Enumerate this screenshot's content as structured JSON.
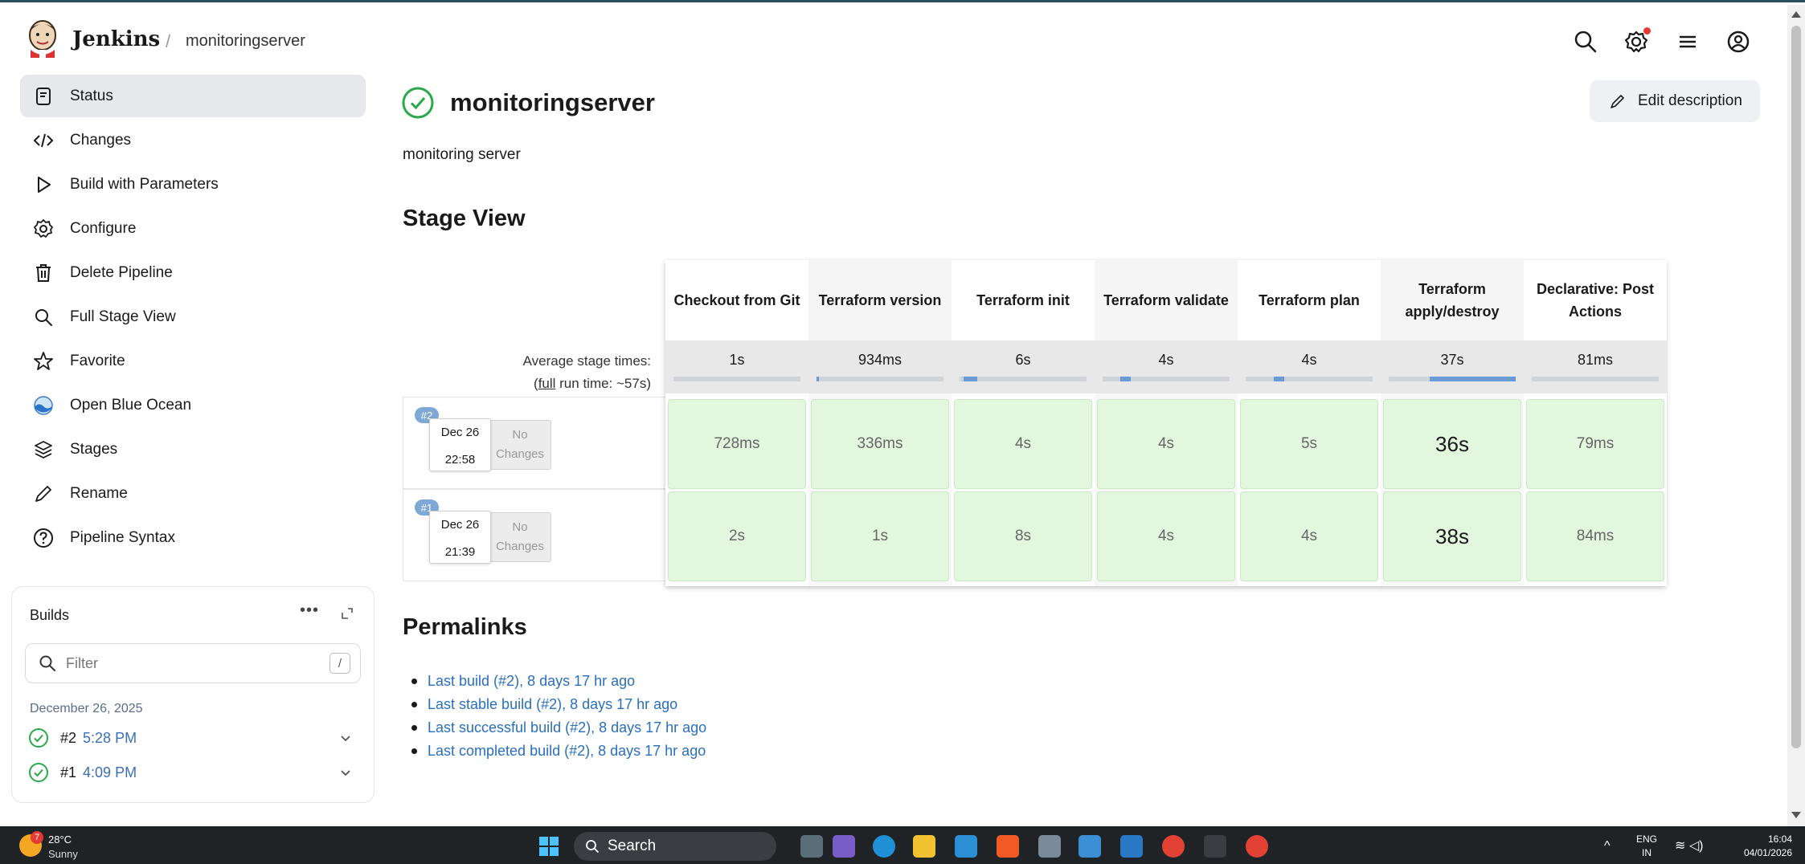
{
  "header": {
    "brand": "Jenkins",
    "breadcrumb_sep": "/",
    "breadcrumb": "monitoringserver"
  },
  "sidebar": {
    "items": [
      {
        "label": "Status",
        "icon": "status-icon"
      },
      {
        "label": "Changes",
        "icon": "code-icon"
      },
      {
        "label": "Build with Parameters",
        "icon": "play-icon"
      },
      {
        "label": "Configure",
        "icon": "gear-icon"
      },
      {
        "label": "Delete Pipeline",
        "icon": "trash-icon"
      },
      {
        "label": "Full Stage View",
        "icon": "search-icon"
      },
      {
        "label": "Favorite",
        "icon": "star-icon"
      },
      {
        "label": "Open Blue Ocean",
        "icon": "blue-ocean-icon"
      },
      {
        "label": "Stages",
        "icon": "layers-icon"
      },
      {
        "label": "Rename",
        "icon": "pencil-icon"
      },
      {
        "label": "Pipeline Syntax",
        "icon": "help-icon"
      }
    ]
  },
  "builds": {
    "title": "Builds",
    "more": "•••",
    "filter_placeholder": "Filter",
    "filter_key": "/",
    "date_group": "December 26, 2025",
    "rows": [
      {
        "num": "#2",
        "time": "5:28 PM"
      },
      {
        "num": "#1",
        "time": "4:09 PM"
      }
    ]
  },
  "main": {
    "title": "monitoringserver",
    "edit_label": "Edit description",
    "description": "monitoring server",
    "stage_view_title": "Stage View",
    "avg_label": "Average stage times:",
    "full_run_prefix": "(",
    "full_run_link": "full",
    "full_run_suffix": " run time: ~57s)",
    "permalinks_title": "Permalinks",
    "permalinks": [
      "Last build (#2), 8 days 17 hr ago",
      "Last stable build (#2), 8 days 17 hr ago",
      "Last successful build (#2), 8 days 17 hr ago",
      "Last completed build (#2), 8 days 17 hr ago"
    ]
  },
  "stages": [
    {
      "name": "Checkout from Git",
      "avg": "1s",
      "bar_start": 0.0,
      "bar_end": 0.0
    },
    {
      "name": "Terraform version",
      "avg": "934ms",
      "bar_start": 0.0,
      "bar_end": 0.02
    },
    {
      "name": "Terraform init",
      "avg": "6s",
      "bar_start": 0.03,
      "bar_end": 0.14
    },
    {
      "name": "Terraform validate",
      "avg": "4s",
      "bar_start": 0.14,
      "bar_end": 0.22
    },
    {
      "name": "Terraform plan",
      "avg": "4s",
      "bar_start": 0.22,
      "bar_end": 0.3
    },
    {
      "name": "Terraform apply/destroy",
      "avg": "37s",
      "bar_start": 0.32,
      "bar_end": 1.0
    },
    {
      "name": "Declarative: Post Actions",
      "avg": "81ms",
      "bar_start": 0.0,
      "bar_end": 0.0
    }
  ],
  "stage_builds": [
    {
      "badge": "#2",
      "date": "Dec 26",
      "time": "22:58",
      "no_changes_1": "No",
      "no_changes_2": "Changes",
      "durations": [
        "728ms",
        "336ms",
        "4s",
        "4s",
        "5s",
        "36s",
        "79ms"
      ]
    },
    {
      "badge": "#1",
      "date": "Dec 26",
      "time": "21:39",
      "no_changes_1": "No",
      "no_changes_2": "Changes",
      "durations": [
        "2s",
        "1s",
        "8s",
        "4s",
        "4s",
        "38s",
        "84ms"
      ]
    }
  ],
  "taskbar": {
    "weather_temp": "28°C",
    "weather_cond": "Sunny",
    "weather_badge": "7",
    "search": "Search",
    "lang_1": "ENG",
    "lang_2": "IN",
    "time": "16:04",
    "date": "04/01/2026"
  },
  "colors": {
    "success": "#2aa84a",
    "stage_cell": "#e2f7de",
    "link": "#2a6fbd",
    "bar": "#6a9bd6"
  }
}
